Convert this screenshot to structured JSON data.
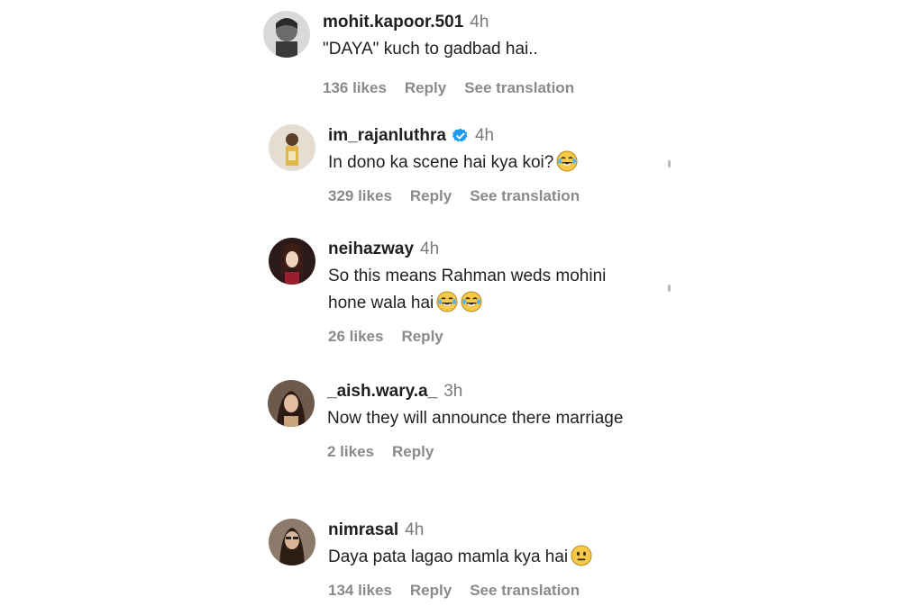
{
  "comments": [
    {
      "username": "mohit.kapoor.501",
      "time": "4h",
      "text": "\"DAYA\" kuch to gadbad hai..",
      "likes": "136 likes",
      "reply": "Reply",
      "translation": "See translation",
      "verified": false
    },
    {
      "username": "im_rajanluthra",
      "time": "4h",
      "text": "In dono ka scene hai kya koi?",
      "likes": "329 likes",
      "reply": "Reply",
      "translation": "See translation",
      "verified": true,
      "emoji": "laughing-tears"
    },
    {
      "username": "neihazway",
      "time": "4h",
      "text": "So this means Rahman weds mohini hone wala hai",
      "likes": "26 likes",
      "reply": "Reply",
      "emoji": "laughing-tears x2"
    },
    {
      "username": "_aish.wary.a_",
      "time": "3h",
      "text": "Now they will announce there marriage",
      "likes": "2 likes",
      "reply": "Reply"
    },
    {
      "username": "nimrasal",
      "time": "4h",
      "text": "Daya pata lagao mamla kya hai",
      "likes": "134 likes",
      "reply": "Reply",
      "translation": "See translation",
      "emoji": "neutral-face"
    }
  ],
  "colors": {
    "verified_badge": "#1d9bf0",
    "muted_text": "#8a8a8a",
    "primary_text": "#1f1f1f"
  }
}
